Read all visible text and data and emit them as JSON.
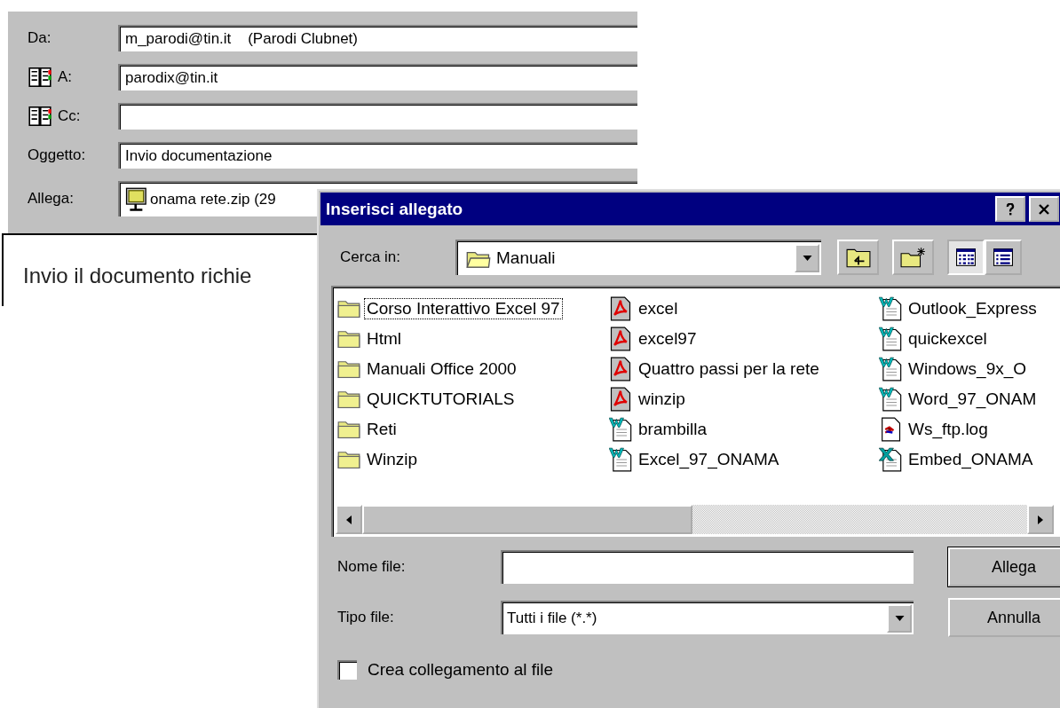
{
  "email": {
    "fields": [
      {
        "label": "Da:",
        "address_book": false,
        "value": "m_parodi@tin.it    (Parodi Clubnet)",
        "attachment": false
      },
      {
        "label": "A:",
        "address_book": true,
        "value": "parodix@tin.it",
        "attachment": false
      },
      {
        "label": "Cc:",
        "address_book": true,
        "attachment": false
      },
      {
        "label": "Oggetto:",
        "address_book": false,
        "value": "Invio documentazione",
        "attachment": false
      },
      {
        "label": "Allega:",
        "address_book": false,
        "value": "onama rete.zip (29",
        "attachment": true
      }
    ],
    "body": "Invio il documento richie"
  },
  "dialog": {
    "title": "Inserisci allegato",
    "look_in": {
      "label": "Cerca in:",
      "value": "Manuali"
    },
    "view_buttons": [
      {
        "kind": "list",
        "selected": true
      },
      {
        "kind": "details",
        "selected": false
      }
    ],
    "files": [
      [
        {
          "name": "Corso Interattivo Excel 97",
          "kind": "folder",
          "focused": true
        },
        {
          "name": "Html",
          "kind": "folder",
          "focused": false
        },
        {
          "name": "Manuali Office 2000",
          "kind": "folder",
          "focused": false
        },
        {
          "name": "QUICKTUTORIALS",
          "kind": "folder",
          "focused": false
        },
        {
          "name": "Reti",
          "kind": "folder",
          "focused": false
        },
        {
          "name": "Winzip",
          "kind": "folder",
          "focused": false
        }
      ],
      [
        {
          "name": "excel",
          "kind": "pdf",
          "focused": false
        },
        {
          "name": "excel97",
          "kind": "pdf",
          "focused": false
        },
        {
          "name": "Quattro passi per la rete",
          "kind": "pdf",
          "focused": false
        },
        {
          "name": "winzip",
          "kind": "pdf",
          "focused": false
        },
        {
          "name": "brambilla",
          "kind": "word",
          "focused": false
        },
        {
          "name": "Excel_97_ONAMA",
          "kind": "word",
          "focused": false
        }
      ],
      [
        {
          "name": "Outlook_Express",
          "kind": "word",
          "focused": false
        },
        {
          "name": "quickexcel",
          "kind": "word",
          "focused": false
        },
        {
          "name": "Windows_9x_O",
          "kind": "word",
          "focused": false
        },
        {
          "name": "Word_97_ONAM",
          "kind": "word",
          "focused": false
        },
        {
          "name": "Ws_ftp.log",
          "kind": "log",
          "focused": false
        },
        {
          "name": "Embed_ONAMA",
          "kind": "excel",
          "focused": false
        }
      ]
    ],
    "file_name": {
      "label": "Nome file:"
    },
    "file_type": {
      "label": "Tipo file:",
      "value": "Tutti i file (*.*)"
    },
    "buttons": [
      "Allega",
      "Annulla"
    ],
    "shortcut": {
      "label": "Crea collegamento al file",
      "checked": false
    }
  }
}
